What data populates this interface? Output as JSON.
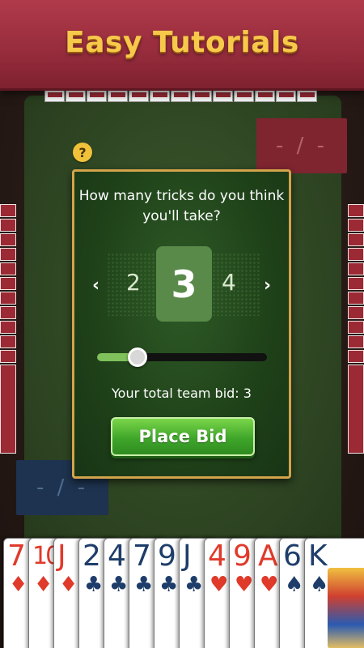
{
  "banner": {
    "title": "Easy Tutorials"
  },
  "scores": {
    "red_team": "- / -",
    "blue_team": "- / -"
  },
  "help": {
    "icon": "question-icon",
    "label": "?"
  },
  "bid_dialog": {
    "question": "How many tricks do you think you'll take?",
    "prev_arrow": "‹",
    "next_arrow": "›",
    "prev_value": "2",
    "current_value": "3",
    "next_value": "4",
    "slider_fraction": 0.2,
    "team_bid_text": "Your total team bid: 3",
    "place_bid_label": "Place Bid"
  },
  "hand": [
    {
      "rank": "7",
      "suit": "♦",
      "color": "red"
    },
    {
      "rank": "10",
      "suit": "♦",
      "color": "red"
    },
    {
      "rank": "J",
      "suit": "♦",
      "color": "red"
    },
    {
      "rank": "2",
      "suit": "♣",
      "color": "black"
    },
    {
      "rank": "4",
      "suit": "♣",
      "color": "black"
    },
    {
      "rank": "7",
      "suit": "♣",
      "color": "black"
    },
    {
      "rank": "9",
      "suit": "♣",
      "color": "black"
    },
    {
      "rank": "J",
      "suit": "♣",
      "color": "black"
    },
    {
      "rank": "4",
      "suit": "♥",
      "color": "red"
    },
    {
      "rank": "9",
      "suit": "♥",
      "color": "red"
    },
    {
      "rank": "A",
      "suit": "♥",
      "color": "red"
    },
    {
      "rank": "6",
      "suit": "♠",
      "color": "black"
    },
    {
      "rank": "K",
      "suit": "♠",
      "color": "black"
    }
  ],
  "colors": {
    "banner": "#962c3c",
    "title_gold": "#f7c94a",
    "felt": "#2f4623",
    "dialog_border": "#d2a34a",
    "button_green": "#3fa62a",
    "red_suit": "#e03a2a",
    "black_suit": "#1e3d6a"
  }
}
